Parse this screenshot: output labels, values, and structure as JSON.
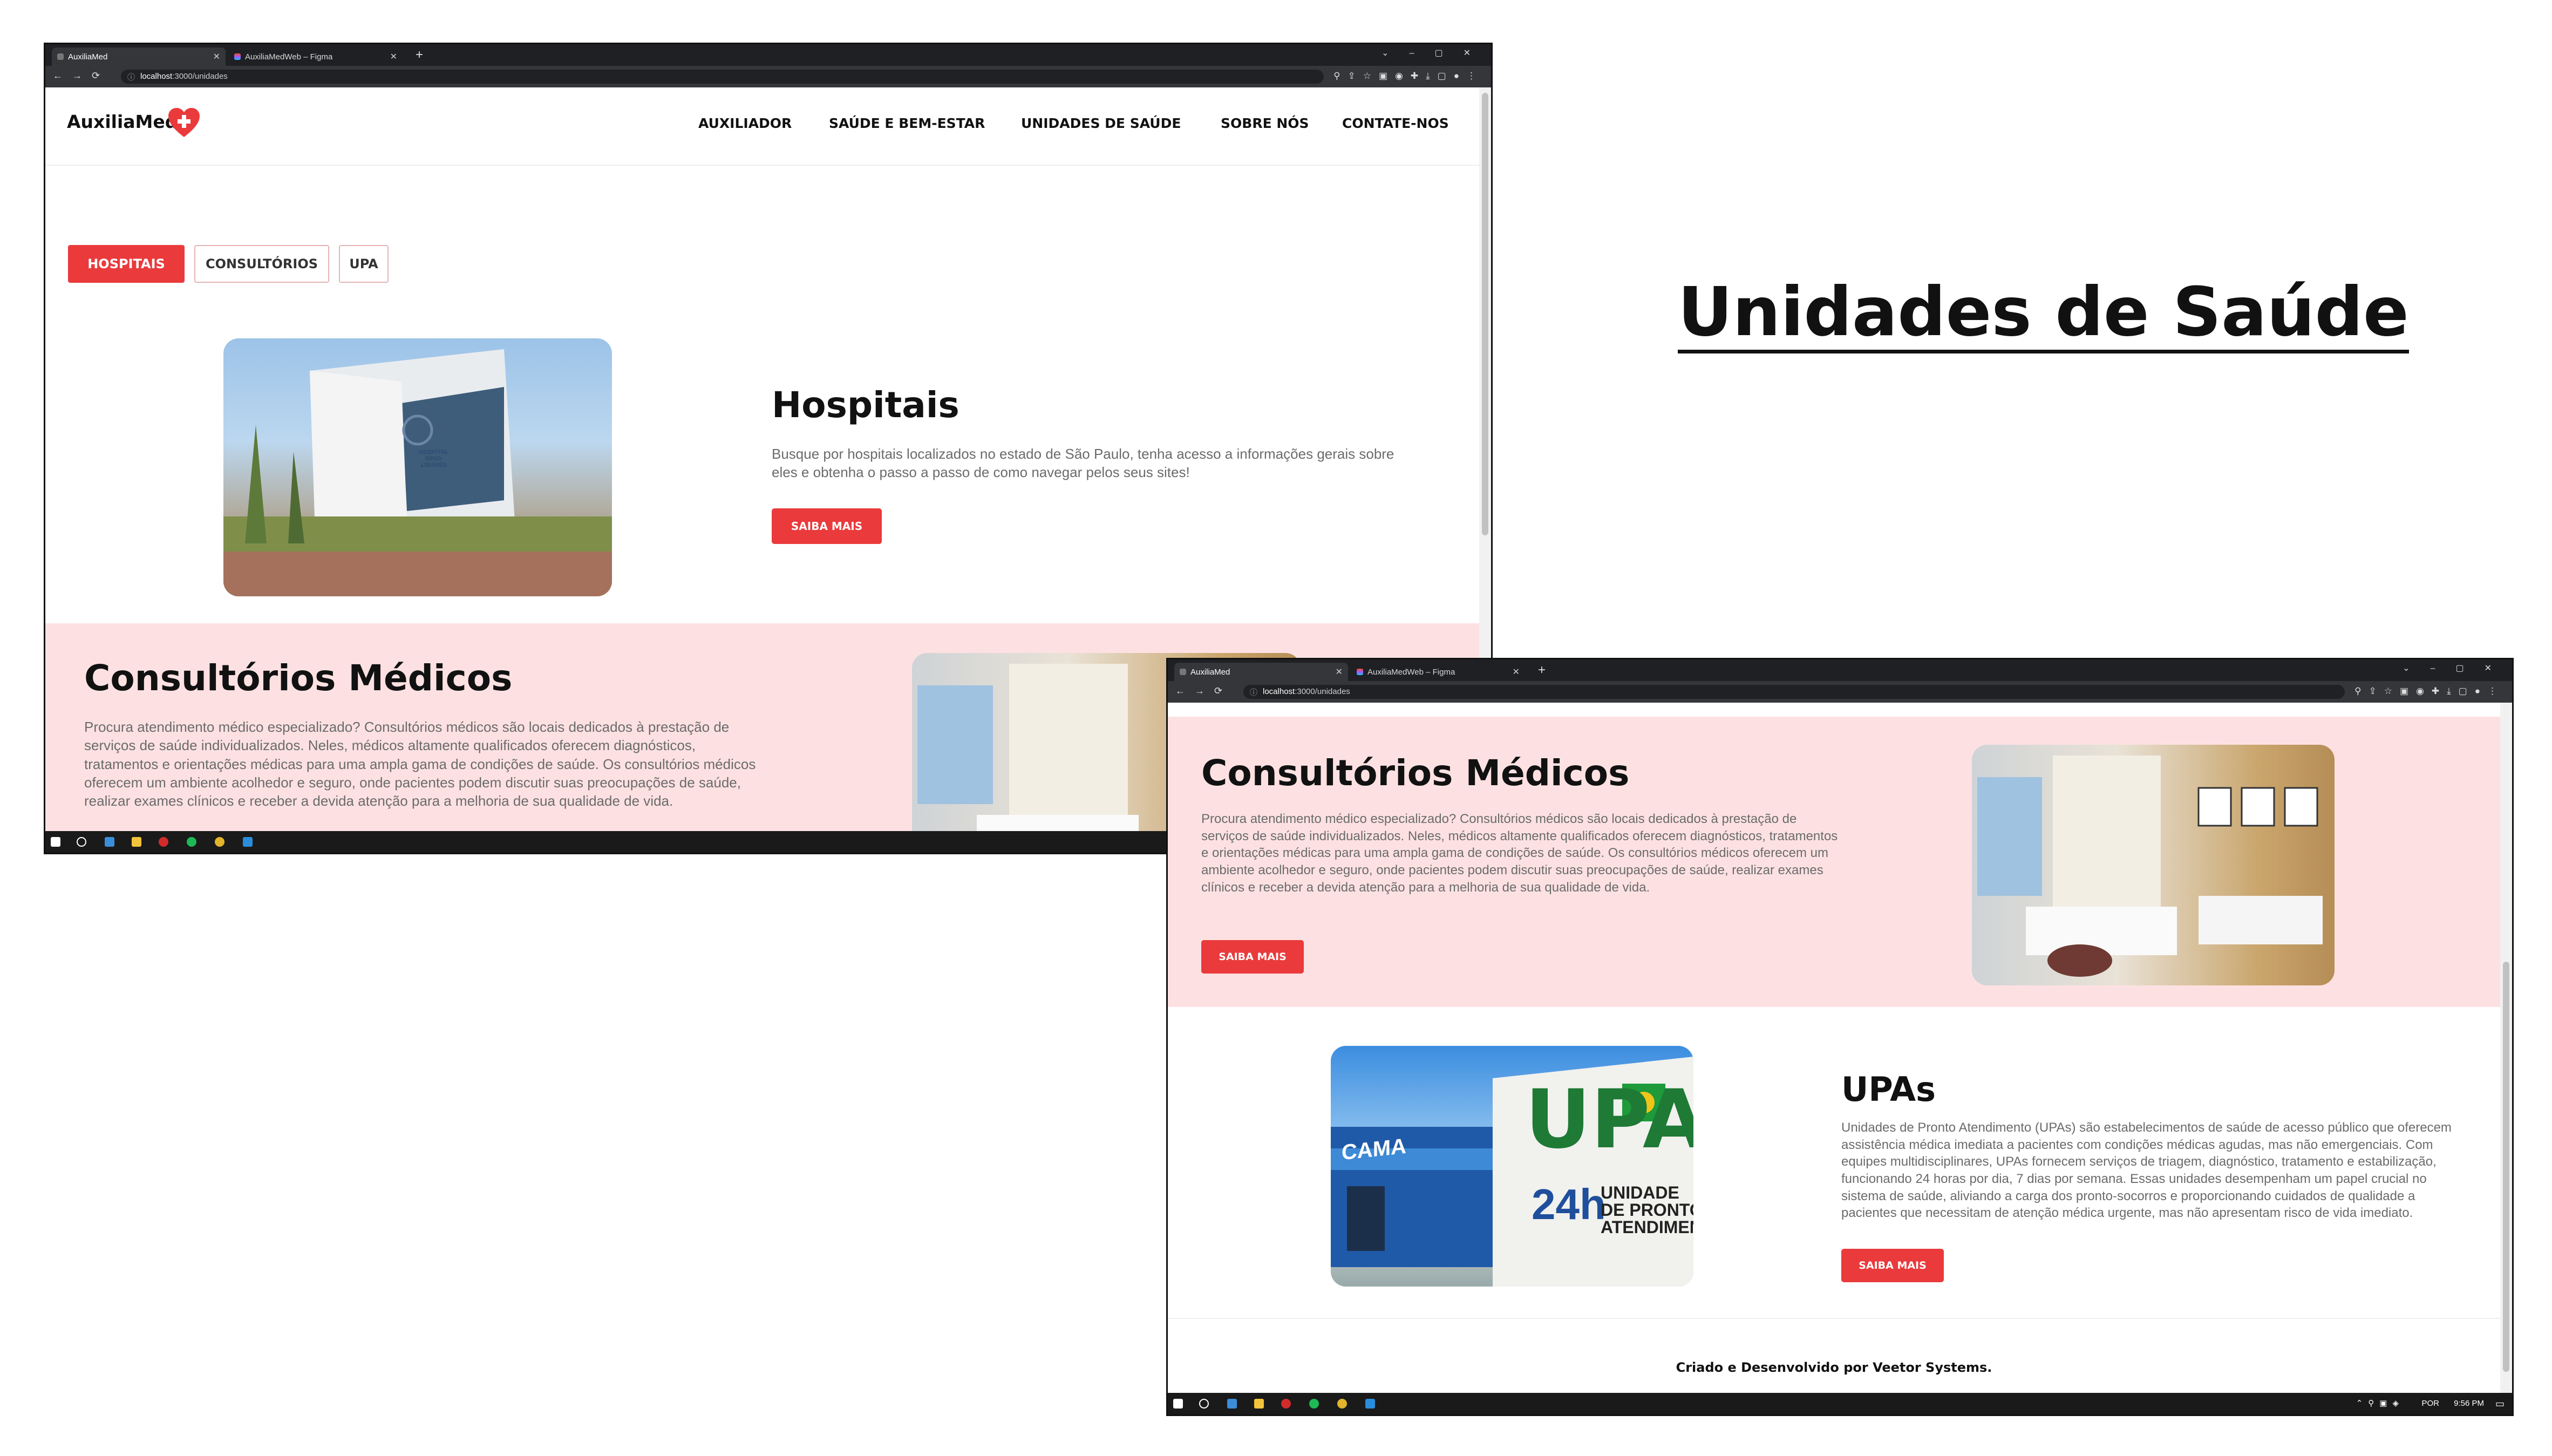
{
  "heading": "Unidades de Saúde",
  "browser": {
    "tab1": "AuxiliaMed",
    "tab2": "AuxiliaMedWeb – Figma",
    "url_host": "localhost",
    "url_path": ":3000/unidades"
  },
  "site": {
    "brand": "AuxiliaMed",
    "nav": [
      "AUXILIADOR",
      "SAÚDE E BEM-ESTAR",
      "UNIDADES DE SAÚDE",
      "SOBRE NÓS",
      "CONTATE-NOS"
    ],
    "filters": [
      "HOSPITAIS",
      "CONSULTÓRIOS",
      "UPA"
    ],
    "hospitais": {
      "title": "Hospitais",
      "text": "Busque por hospitais localizados no estado de São Paulo, tenha acesso a informações gerais sobre eles e obtenha o passo a passo de como navegar pelos seus sites!",
      "button": "SAIBA MAIS",
      "sign_text": "HOSPITAL SÍRIO-LIBANÊS"
    },
    "consultorios": {
      "title": "Consultórios Médicos",
      "text": "Procura atendimento médico especializado? Consultórios médicos são locais dedicados à prestação de serviços de saúde individualizados. Neles, médicos altamente qualificados oferecem diagnósticos, tratamentos e orientações médicas para uma ampla gama de condições de saúde. Os consultórios médicos oferecem um ambiente acolhedor e seguro, onde pacientes podem discutir suas preocupações de saúde, realizar exames clínicos e receber a devida atenção para a melhoria de sua qualidade de vida.",
      "button": "SAIBA MAIS"
    },
    "upas": {
      "title": "UPAs",
      "text": "Unidades de Pronto Atendimento (UPAs) são estabelecimentos de saúde de acesso público que oferecem assistência médica imediata a pacientes com condições médicas agudas, mas não emergenciais. Com equipes multidisciplinares, UPAs fornecem serviços de triagem, diagnóstico, tratamento e estabilização, funcionando 24 horas por dia, 7 dias por semana. Essas unidades desempenham um papel crucial no sistema de saúde, aliviando a carga dos pronto-socorros e proporcionando cuidados de qualidade a pacientes que necessitam de atenção médica urgente, mas não apresentam risco de vida imediato.",
      "button": "SAIBA MAIS",
      "sign_upa": "UPA",
      "sign_24h": "24h",
      "sign_line1": "UNIDADE",
      "sign_line2": "DE PRONTO",
      "sign_line3": "ATENDIMENTO",
      "sign_side": "CAMA"
    },
    "footer": "Criado e Desenvolvido por Veetor Systems."
  },
  "taskbar": {
    "lang": "POR",
    "time": "9:56 PM"
  },
  "colors": {
    "accent": "#ea3a3c",
    "pink_band": "#fde1e2",
    "chrome_dark": "#35363a"
  }
}
